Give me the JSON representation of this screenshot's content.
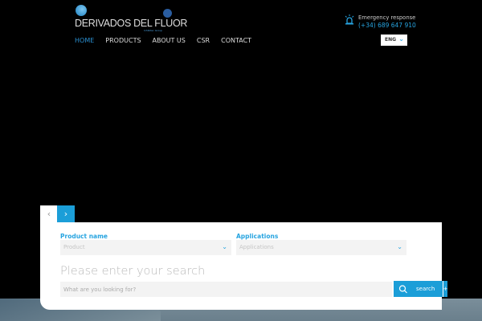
{
  "logo": {
    "name": "DERIVADOS DEL FLUOR",
    "subtitle": "Inhibitec Group"
  },
  "nav": {
    "items": [
      {
        "label": "HOME",
        "active": true
      },
      {
        "label": "PRODUCTS"
      },
      {
        "label": "ABOUT US"
      },
      {
        "label": "CSR"
      },
      {
        "label": "CONTACT"
      }
    ]
  },
  "emergency": {
    "label": "Emergency response",
    "phone": "(+34) 689 647 910"
  },
  "language": {
    "selected": "ENG"
  },
  "search": {
    "product_label": "Product name",
    "product_placeholder": "Product",
    "applications_label": "Applications",
    "applications_placeholder": "Applications",
    "heading": "Please enter your search",
    "input_placeholder": "What are you looking for?",
    "button_label": "search",
    "plus": "+"
  },
  "colors": {
    "accent": "#1b9ed8"
  }
}
